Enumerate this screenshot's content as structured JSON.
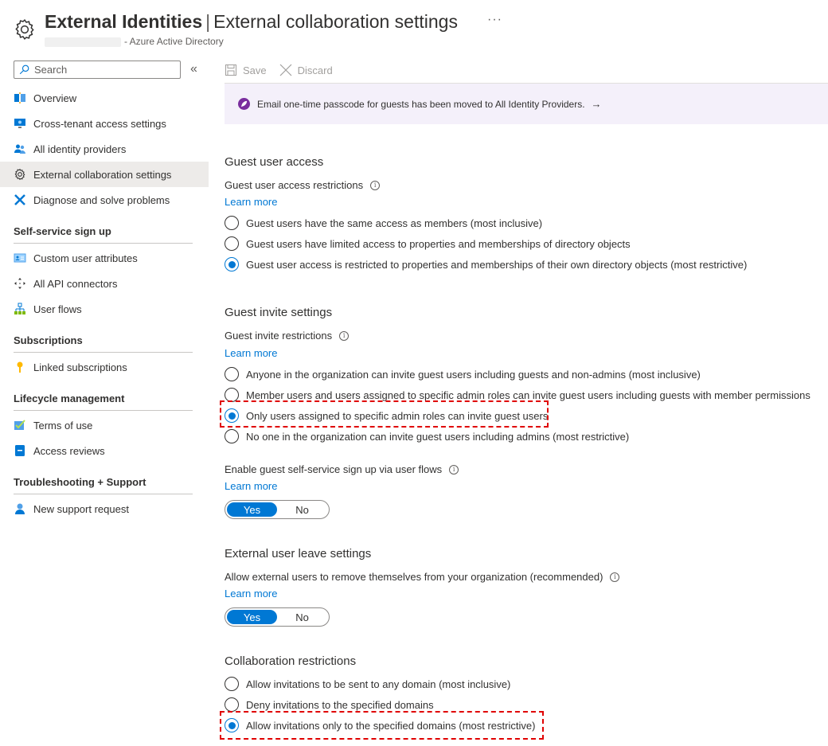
{
  "header": {
    "blade_title": "External Identities",
    "separator": "|",
    "page_title": "External collaboration settings",
    "more_label": "···",
    "subtitle": "- Azure Active Directory"
  },
  "sidebar": {
    "search_placeholder": "Search",
    "collapse_label": "«",
    "items": [
      {
        "label": "Overview",
        "icon": "overview-icon"
      },
      {
        "label": "Cross-tenant access settings",
        "icon": "monitor-icon"
      },
      {
        "label": "All identity providers",
        "icon": "users-icon"
      },
      {
        "label": "External collaboration settings",
        "icon": "gear-icon",
        "selected": true
      },
      {
        "label": "Diagnose and solve problems",
        "icon": "wrench-icon"
      }
    ],
    "sections": [
      {
        "title": "Self-service sign up",
        "items": [
          {
            "label": "Custom user attributes",
            "icon": "id-card-icon"
          },
          {
            "label": "All API connectors",
            "icon": "move-arrows-icon"
          },
          {
            "label": "User flows",
            "icon": "hierarchy-icon"
          }
        ]
      },
      {
        "title": "Subscriptions",
        "items": [
          {
            "label": "Linked subscriptions",
            "icon": "key-icon"
          }
        ]
      },
      {
        "title": "Lifecycle management",
        "items": [
          {
            "label": "Terms of use",
            "icon": "checkmark-icon"
          },
          {
            "label": "Access reviews",
            "icon": "book-icon"
          }
        ]
      },
      {
        "title": "Troubleshooting + Support",
        "items": [
          {
            "label": "New support request",
            "icon": "support-person-icon"
          }
        ]
      }
    ]
  },
  "toolbar": {
    "save_label": "Save",
    "discard_label": "Discard"
  },
  "banner": {
    "text": "Email one-time passcode for guests has been moved to All Identity Providers.",
    "arrow": "→"
  },
  "guest_user_access": {
    "title": "Guest user access",
    "label": "Guest user access restrictions",
    "learn_more": "Learn more",
    "options": [
      {
        "label": "Guest users have the same access as members (most inclusive)",
        "selected": false
      },
      {
        "label": "Guest users have limited access to properties and memberships of directory objects",
        "selected": false
      },
      {
        "label": "Guest user access is restricted to properties and memberships of their own directory objects (most restrictive)",
        "selected": true
      }
    ]
  },
  "guest_invite": {
    "title": "Guest invite settings",
    "label": "Guest invite restrictions",
    "learn_more": "Learn more",
    "options": [
      {
        "label": "Anyone in the organization can invite guest users including guests and non-admins (most inclusive)",
        "selected": false
      },
      {
        "label": "Member users and users assigned to specific admin roles can invite guest users including guests with member permissions",
        "selected": false
      },
      {
        "label": "Only users assigned to specific admin roles can invite guest users",
        "selected": true
      },
      {
        "label": "No one in the organization can invite guest users including admins (most restrictive)",
        "selected": false
      }
    ],
    "self_service_label": "Enable guest self-service sign up via user flows",
    "self_service_learn_more": "Learn more",
    "self_service_toggle": {
      "yes": "Yes",
      "no": "No",
      "value": "Yes"
    }
  },
  "external_leave": {
    "title": "External user leave settings",
    "label": "Allow external users to remove themselves from your organization (recommended)",
    "learn_more": "Learn more",
    "toggle": {
      "yes": "Yes",
      "no": "No",
      "value": "Yes"
    }
  },
  "collaboration": {
    "title": "Collaboration restrictions",
    "options": [
      {
        "label": "Allow invitations to be sent to any domain (most inclusive)",
        "selected": false
      },
      {
        "label": "Deny invitations to the specified domains",
        "selected": false
      },
      {
        "label": "Allow invitations only to the specified domains (most restrictive)",
        "selected": true
      }
    ]
  },
  "colors": {
    "accent": "#0078d4",
    "highlight": "#e00000",
    "banner_bg": "#f4f0fa",
    "banner_icon": "#7a2e9e",
    "selected_nav": "#edebe9"
  }
}
